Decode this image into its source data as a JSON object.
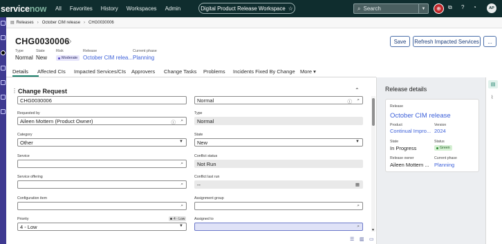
{
  "topnav": {
    "logo_a": "service",
    "logo_b": "now",
    "links": [
      "All",
      "Favorites",
      "History",
      "Workspaces",
      "Admin"
    ],
    "workspace": "Digital Product Release Workspace",
    "search_placeholder": "Search",
    "avatar_initials": "AP"
  },
  "breadcrumb": [
    "Releases",
    "October CIM release",
    "CHG0030006"
  ],
  "record": {
    "number": "CHG0030006",
    "meta": [
      {
        "label": "Type",
        "value": "Normal"
      },
      {
        "label": "State",
        "value": "New"
      },
      {
        "label": "Risk",
        "value": "Moderate"
      },
      {
        "label": "Release",
        "value": "October CIM relea..."
      },
      {
        "label": "Current phase",
        "value": "Planning"
      }
    ]
  },
  "actions": {
    "save": "Save",
    "refresh": "Refresh Impacted Services",
    "more": "..."
  },
  "tabs": [
    "Details",
    "Affected CIs",
    "Impacted Services/CIs",
    "Approvers",
    "Change Tasks",
    "Problems",
    "Incidents Fixed By Change",
    "More"
  ],
  "section": {
    "title": "Change Request"
  },
  "form": {
    "number_value": "CHG0030006",
    "model_value": "Normal",
    "requested_by_label": "Requested by",
    "requested_by_value": "Aileen Mottern (Product Owner)",
    "type_label": "Type",
    "type_value": "Normal",
    "category_label": "Category",
    "category_value": "Other",
    "state_label": "State",
    "state_value": "New",
    "service_label": "Service",
    "service_value": "",
    "conflict_status_label": "Conflict status",
    "conflict_status_value": "Not Run",
    "service_offering_label": "Service offering",
    "service_offering_value": "",
    "conflict_last_run_label": "Conflict last run",
    "conflict_last_run_value": "--",
    "config_item_label": "Configuration item",
    "config_item_value": "",
    "assignment_group_label": "Assignment group",
    "assignment_group_value": "",
    "priority_label": "Priority",
    "priority_badge": "4 - Low",
    "priority_value": "4 - Low",
    "assigned_to_label": "Assigned to",
    "assigned_to_value": ""
  },
  "release_details": {
    "title": "Release details",
    "release_label": "Release",
    "release_value": "October CIM release",
    "product_label": "Product",
    "product_value": "Continual Impro...",
    "version_label": "Version",
    "version_value": "2024",
    "state_label": "State",
    "state_value": "In Progress",
    "status_label": "Status",
    "status_value": "Green",
    "owner_label": "Release owner",
    "owner_value": "Aileen Mottern ...",
    "phase_label": "Current phase",
    "phase_value": "Planning"
  },
  "colors": {
    "nav": "#0f2d2e",
    "accent": "#1a7f6a",
    "link": "#3b5fd9",
    "rail": "#3f3a91"
  }
}
